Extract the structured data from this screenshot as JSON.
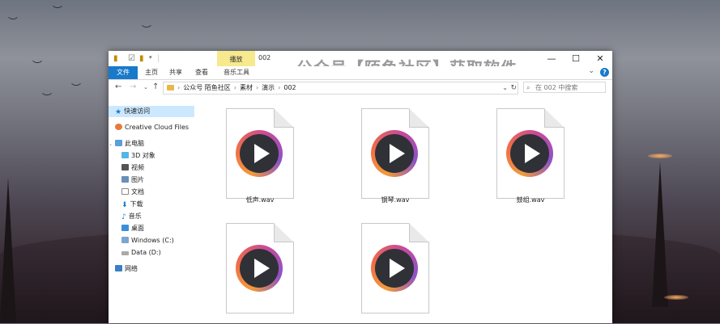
{
  "window": {
    "manage_tab": "播放",
    "title": "002",
    "watermark": "公众号【陌鱼社区】获取软件",
    "controls": {
      "minimize": "—",
      "maximize": "☐",
      "close": "✕"
    }
  },
  "ribbon": {
    "tabs": [
      "文件",
      "主页",
      "共享",
      "查看",
      "音乐工具"
    ],
    "help": "?"
  },
  "address": {
    "breadcrumbs": [
      "公众号 陌鱼社区",
      "素材",
      "演示",
      "002"
    ],
    "search_placeholder": "在 002 中搜索"
  },
  "sidebar": {
    "quick_access": "快速访问",
    "creative_cloud": "Creative Cloud Files",
    "this_pc": "此电脑",
    "items": [
      "3D 对象",
      "视频",
      "图片",
      "文档",
      "下载",
      "音乐",
      "桌面",
      "Windows (C:)",
      "Data (D:)"
    ],
    "network": "网络"
  },
  "files": [
    {
      "name": "低声.wav"
    },
    {
      "name": "钢琴.wav"
    },
    {
      "name": "鼓组.wav"
    },
    {
      "name": ""
    },
    {
      "name": ""
    }
  ],
  "colors": {
    "accent": "#1979ca",
    "manage_tab": "#f6e98e",
    "selected": "#cce8ff"
  }
}
